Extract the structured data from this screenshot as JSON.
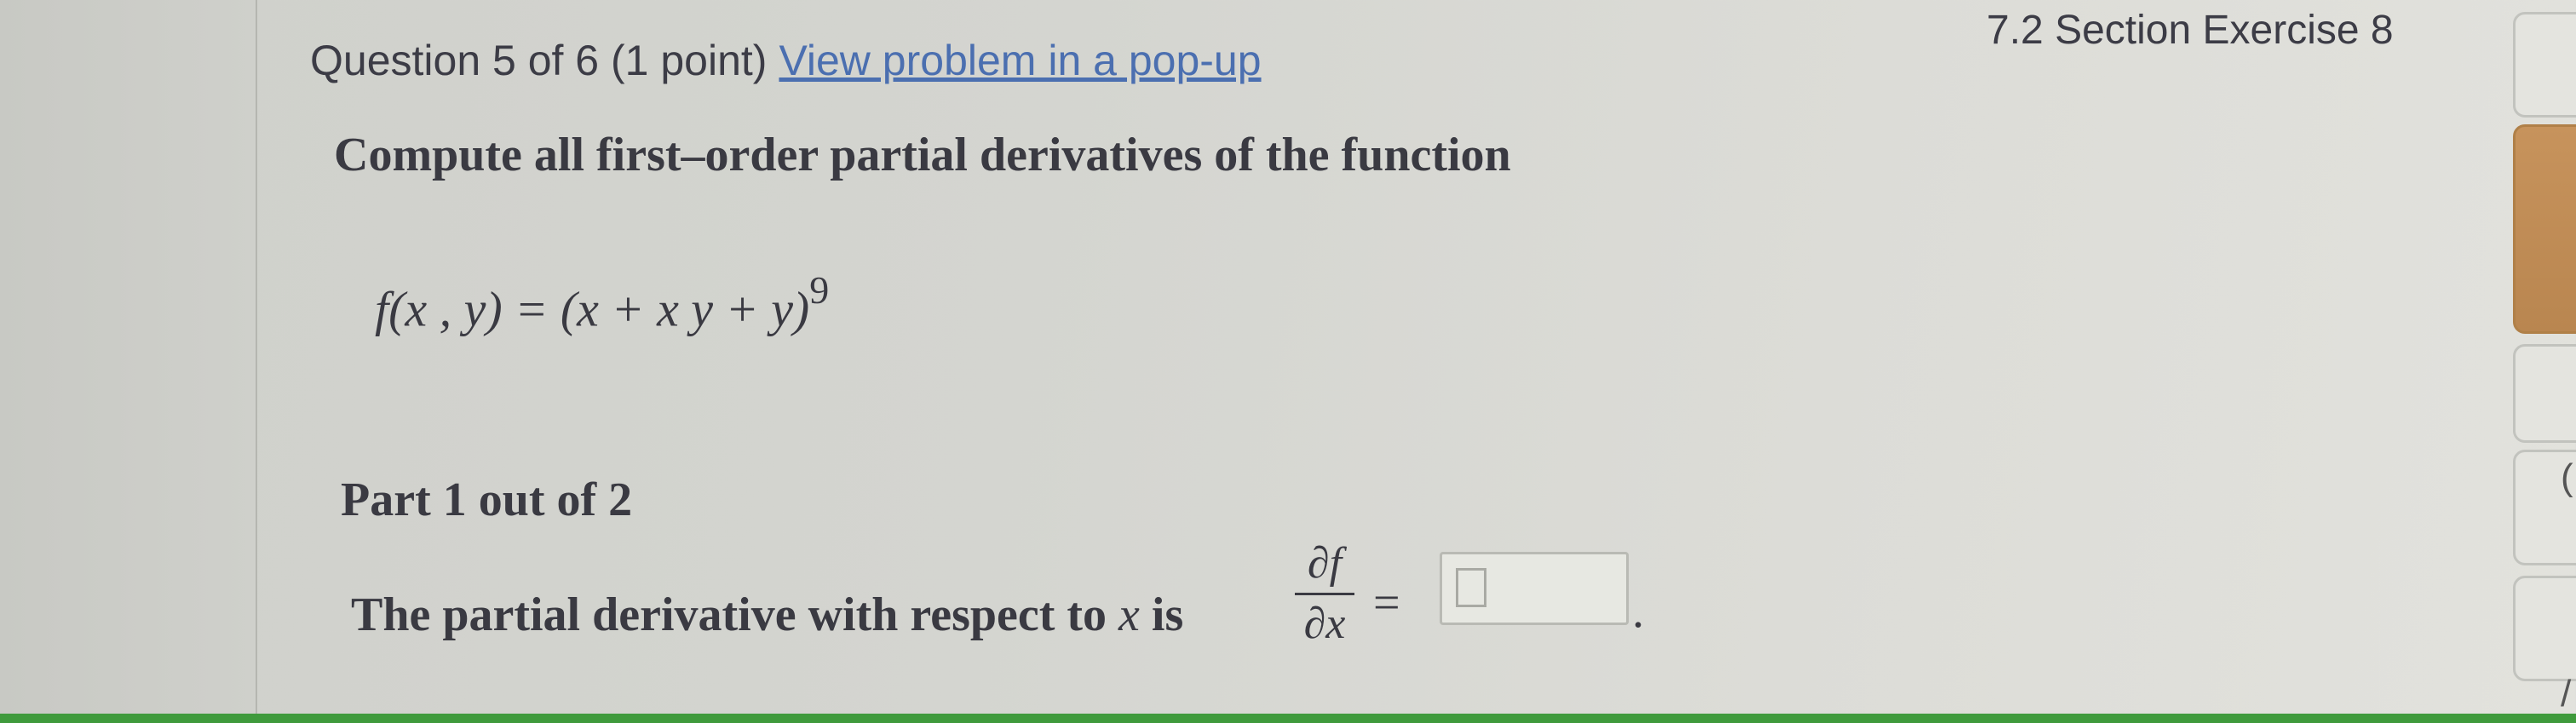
{
  "question": {
    "header": "Question 5 of 6 (1 point)",
    "popup_link": "View problem in a pop-up",
    "section": "7.2 Section Exercise 8"
  },
  "problem": {
    "instruction": "Compute all first–order partial derivatives of the function",
    "function_lhs": "f(x , y) = (x + x y + y)",
    "function_exponent": "9"
  },
  "part": {
    "label": "Part 1 out of 2",
    "prompt_text": "The partial derivative with respect to",
    "prompt_var": "x",
    "prompt_is": "is",
    "numerator": "∂f",
    "denominator": "∂x",
    "equals": "=",
    "answer_value": "",
    "end_period": "."
  },
  "sidebar": {
    "edge_glyph_1": "(",
    "edge_glyph_2": "/"
  },
  "colors": {
    "link": "#4b6fb0",
    "accent_button": "#c7935c",
    "bottom_bar": "#3f9a3c"
  }
}
